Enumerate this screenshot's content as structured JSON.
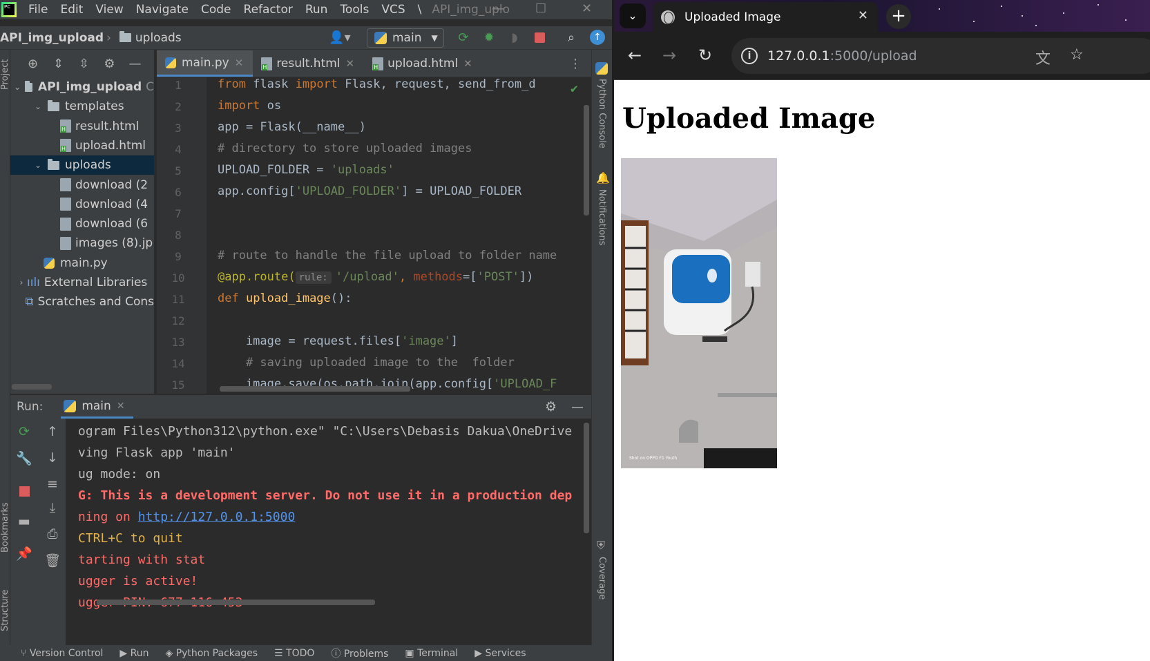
{
  "ide": {
    "menu": [
      "File",
      "Edit",
      "View",
      "Navigate",
      "Code",
      "Refactor",
      "Run",
      "Tools",
      "VCS",
      "\\"
    ],
    "window_title": "API_img_uplo",
    "project_name": "API_img_upload",
    "breadcrumb_folder": "uploads",
    "branch": "main",
    "project_tree": [
      {
        "label": "API_img_upload",
        "suffix": "C",
        "type": "folder",
        "expanded": true,
        "depth": 0
      },
      {
        "label": "templates",
        "type": "folder",
        "expanded": true,
        "depth": 1
      },
      {
        "label": "result.html",
        "type": "html",
        "depth": 2
      },
      {
        "label": "upload.html",
        "type": "html",
        "depth": 2
      },
      {
        "label": "uploads",
        "type": "folder",
        "expanded": true,
        "depth": 1,
        "selected": true
      },
      {
        "label": "download (2",
        "type": "img",
        "depth": 2
      },
      {
        "label": "download (4",
        "type": "img",
        "depth": 2
      },
      {
        "label": "download (6",
        "type": "img",
        "depth": 2
      },
      {
        "label": "images (8).jp",
        "type": "img",
        "depth": 2
      },
      {
        "label": "main.py",
        "type": "py",
        "depth": 1
      },
      {
        "label": "External Libraries",
        "type": "lib",
        "depth": 0
      },
      {
        "label": "Scratches and Cons",
        "type": "scratch",
        "depth": 0
      }
    ],
    "tabs": [
      {
        "label": "main.py",
        "active": true
      },
      {
        "label": "result.html",
        "active": false
      },
      {
        "label": "upload.html",
        "active": false
      }
    ],
    "line_numbers": [
      "1",
      "2",
      "3",
      "4",
      "5",
      "6",
      "7",
      "8",
      "9",
      "10",
      "11",
      "12",
      "13",
      "14",
      "15"
    ],
    "code": {
      "l1_kw1": "from",
      "l1_a": " flask ",
      "l1_kw2": "import",
      "l1_b": " Flask, request, send_from_d",
      "l2_kw": "import",
      "l2_a": " os",
      "l3": "app = Flask(__name__)",
      "l4": "# directory to store uploaded images",
      "l5_a": "UPLOAD_FOLDER = ",
      "l5_s": "'uploads'",
      "l6_a": "app.config[",
      "l6_s": "'UPLOAD_FOLDER'",
      "l6_b": "] = UPLOAD_FOLDER",
      "l9": "# route to handle the file upload to folder name",
      "l10_dec": "@app.route(",
      "l10_hint": "rule:",
      "l10_s": "'/upload'",
      "l10_c": ", ",
      "l10_p": "methods",
      "l10_e": "=[",
      "l10_s2": "'POST'",
      "l10_f": "])",
      "l11_kw": "def",
      "l11_fn": " upload_image",
      "l11_a": "():",
      "l13_a": "    image = request.files[",
      "l13_s": "'image'",
      "l13_b": "]",
      "l14": "    # saving uploaded image to the  folder",
      "l15_a": "    image.save(os.path.join(app.config[",
      "l15_s": "'UPLOAD_F"
    },
    "run": {
      "label": "Run:",
      "config": "main",
      "lines": {
        "c1": "ogram Files\\Python312\\python.exe\" \"C:\\Users\\Debasis Dakua\\OneDrive",
        "c2": "ving Flask app 'main'",
        "c3": "ug mode: on",
        "c4": "G: This is a development server. Do not use it in a production dep",
        "c5_a": "ning on ",
        "c5_link": "http://127.0.0.1:5000",
        "c6": "CTRL+C to quit",
        "c7": "tarting with stat",
        "c8": "ugger is active!",
        "c9": "ugger PIN: 677-116-453"
      }
    },
    "side_labels": {
      "project": "Project",
      "bookmarks": "Bookmarks",
      "structure": "Structure",
      "python_console": "Python Console",
      "notifications": "Notifications",
      "coverage": "Coverage"
    },
    "status": [
      "Version Control",
      "Run",
      "Python Packages",
      "TODO",
      "Problems",
      "Terminal",
      "Services"
    ]
  },
  "browser": {
    "tab_title": "Uploaded Image",
    "url_host": "127.0.0.1",
    "url_path": ":5000/upload",
    "heading": "Uploaded Image",
    "photo_caption": "Shot on OPPO F1 Youth"
  },
  "colors": {
    "accent": "#4a88c7",
    "error": "#ff6b68",
    "run_green": "#499c54"
  }
}
